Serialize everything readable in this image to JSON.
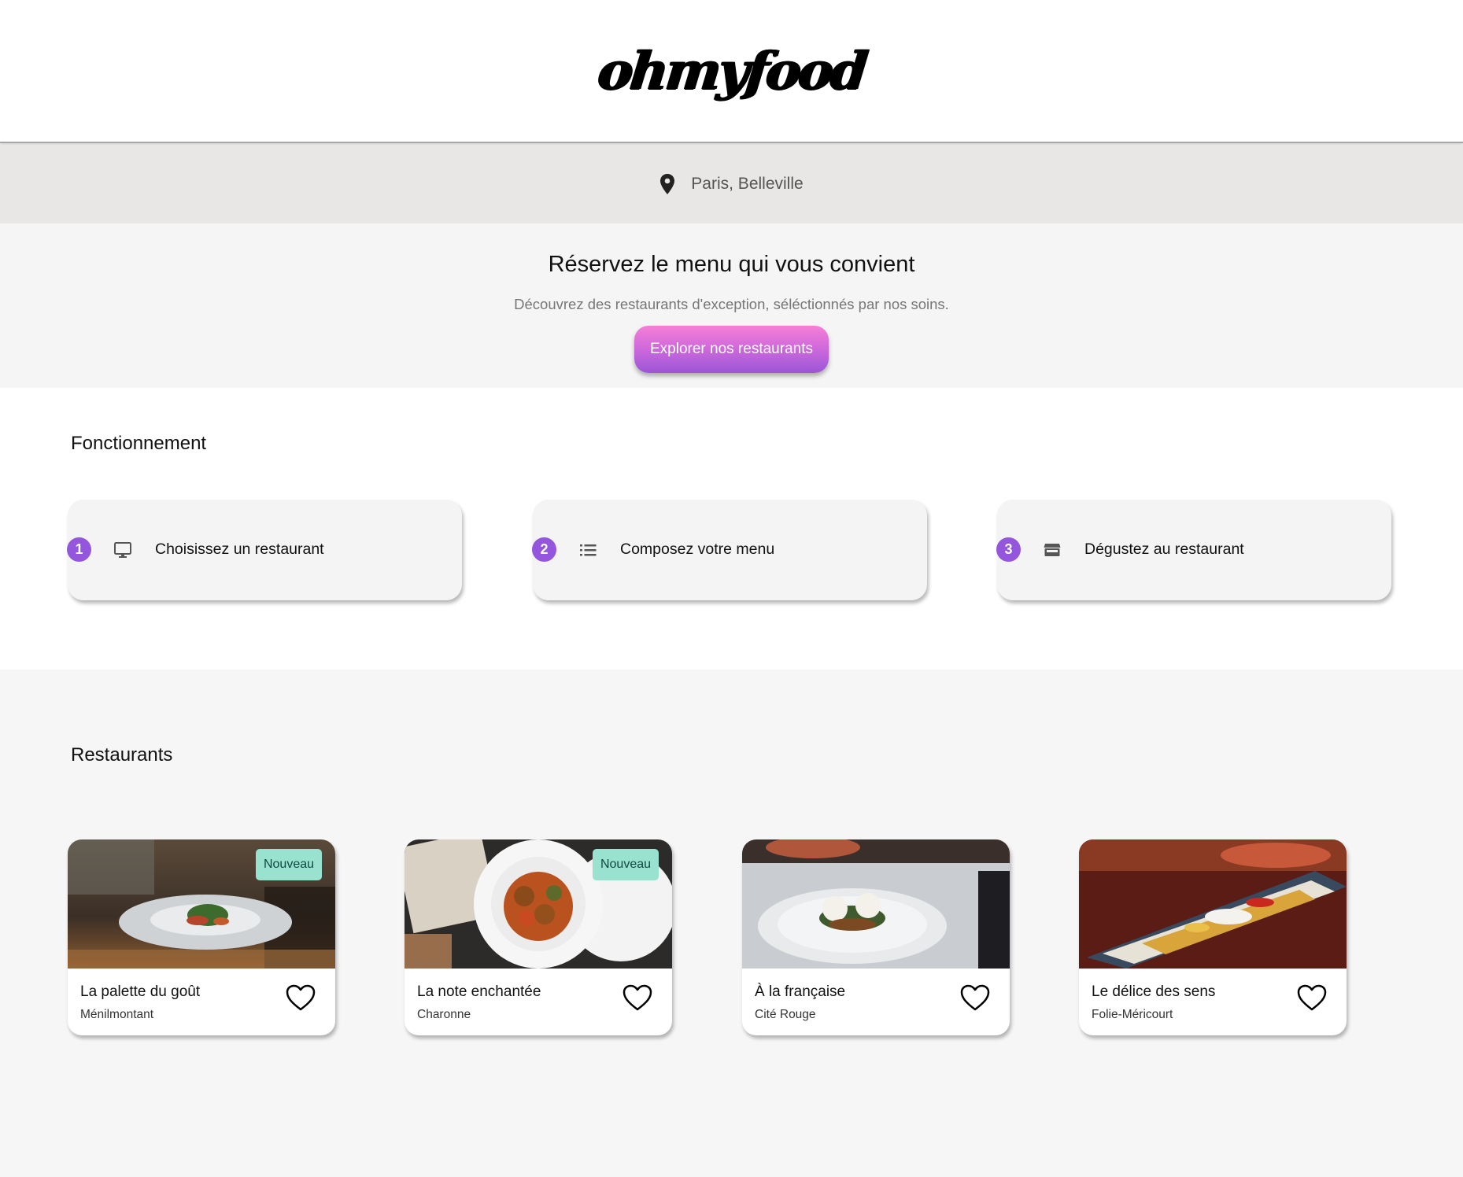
{
  "header": {
    "logo": "ohmyfood"
  },
  "location": {
    "icon": "location-pin-icon",
    "text": "Paris, Belleville"
  },
  "hero": {
    "title": "Réservez le menu qui vous convient",
    "subtitle": "Découvrez des restaurants d'exception, séléctionnés par nos soins.",
    "cta_label": "Explorer nos restaurants"
  },
  "how": {
    "title": "Fonctionnement",
    "steps": [
      {
        "number": "1",
        "icon": "monitor-icon",
        "label": "Choisissez un restaurant"
      },
      {
        "number": "2",
        "icon": "list-icon",
        "label": "Composez votre menu"
      },
      {
        "number": "3",
        "icon": "storefront-icon",
        "label": "Dégustez au restaurant"
      }
    ]
  },
  "restaurants": {
    "title": "Restaurants",
    "items": [
      {
        "name": "La palette du goût",
        "district": "Ménilmontant",
        "badge": "Nouveau",
        "icon": "heart-outline-icon"
      },
      {
        "name": "La note enchantée",
        "district": "Charonne",
        "badge": "Nouveau",
        "icon": "heart-outline-icon"
      },
      {
        "name": "À la française",
        "district": "Cité Rouge",
        "badge": "",
        "icon": "heart-outline-icon"
      },
      {
        "name": "Le délice des sens",
        "district": "Folie-Méricourt",
        "badge": "",
        "icon": "heart-outline-icon"
      }
    ]
  },
  "colors": {
    "accent": "#9356dc",
    "cta_gradient_top": "#f57fd6",
    "cta_gradient_bottom": "#9b56d8",
    "badge_bg": "#99e2d0",
    "location_bar": "#e8e7e5"
  }
}
